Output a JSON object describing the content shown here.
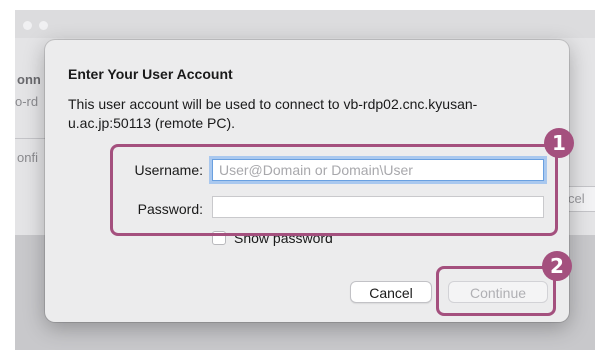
{
  "background": {
    "text_partial_1": "onn",
    "text_partial_2": "o-rd",
    "text_partial_3": "onfi",
    "button_partial": "cel"
  },
  "dialog": {
    "title": "Enter Your User Account",
    "description": "This user account will be used to connect to vb-rdp02.cnc.kyusan-u.ac.jp:50113 (remote PC).",
    "username_label": "Username:",
    "username_placeholder": "User@Domain or Domain\\User",
    "username_value": "",
    "password_label": "Password:",
    "password_value": "",
    "show_password_label": "Show password",
    "show_password_checked": false,
    "cancel_label": "Cancel",
    "continue_label": "Continue",
    "continue_enabled": false
  },
  "annotations": {
    "badge_1": "1",
    "badge_2": "2",
    "color": "#a4507e"
  }
}
